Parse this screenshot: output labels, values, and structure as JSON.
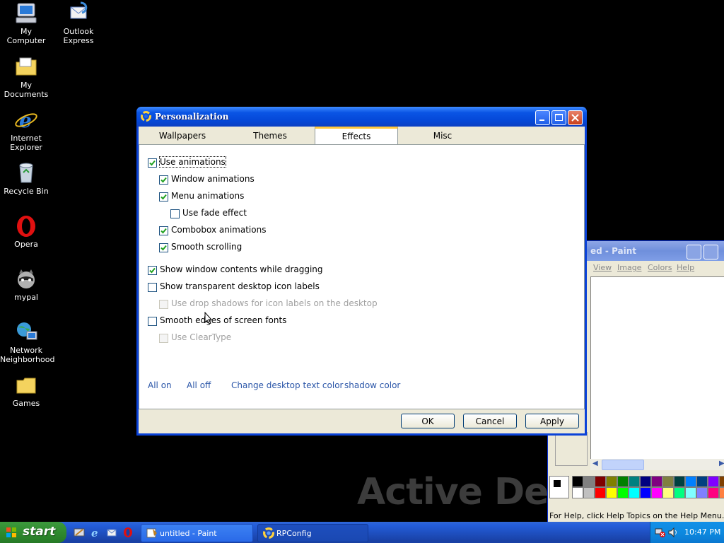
{
  "desktop": {
    "icons": [
      {
        "name": "My Computer"
      },
      {
        "name": "Outlook Express"
      },
      {
        "name": "My Documents"
      },
      {
        "name": "Internet Explorer"
      },
      {
        "name": "Recycle Bin"
      },
      {
        "name": "Opera"
      },
      {
        "name": "mypal"
      },
      {
        "name": "Network Neighborhood"
      },
      {
        "name": "Games"
      }
    ],
    "watermark": "Active Des"
  },
  "paint": {
    "title": "ed - Paint",
    "menu": [
      "View",
      "Image",
      "Colors",
      "Help"
    ],
    "status": "For Help, click Help Topics on the Help Menu.",
    "palette_top": [
      "#000000",
      "#808080",
      "#800000",
      "#808000",
      "#008000",
      "#008080",
      "#000080",
      "#800080",
      "#808040",
      "#004040",
      "#0080ff",
      "#004080",
      "#8000ff",
      "#804000"
    ],
    "palette_bottom": [
      "#ffffff",
      "#c0c0c0",
      "#ff0000",
      "#ffff00",
      "#00ff00",
      "#00ffff",
      "#0000ff",
      "#ff00ff",
      "#ffff80",
      "#00ff80",
      "#80ffff",
      "#8080ff",
      "#ff0080",
      "#ff8040"
    ]
  },
  "dialog": {
    "title": "Personalization",
    "tabs": [
      "Wallpapers",
      "Themes",
      "Effects",
      "Misc"
    ],
    "active_tab": "Effects",
    "options": {
      "use_animations": {
        "label": "Use animations",
        "checked": true
      },
      "window_animations": {
        "label": "Window animations",
        "checked": true
      },
      "menu_animations": {
        "label": "Menu animations",
        "checked": true
      },
      "use_fade_effect": {
        "label": "Use fade effect",
        "checked": false
      },
      "combobox_animations": {
        "label": "Combobox animations",
        "checked": true
      },
      "smooth_scrolling": {
        "label": "Smooth scrolling",
        "checked": true
      },
      "show_window_contents": {
        "label": "Show window contents while dragging",
        "checked": true
      },
      "transparent_icon_labels": {
        "label": "Show transparent desktop icon labels",
        "checked": false
      },
      "drop_shadows": {
        "label": "Use drop shadows for icon labels on the desktop",
        "checked": false,
        "disabled": true
      },
      "smooth_fonts": {
        "label": "Smooth edges of screen fonts",
        "checked": false
      },
      "use_cleartype": {
        "label": "Use ClearType",
        "checked": false,
        "disabled": true
      }
    },
    "links": {
      "all_on": "All on",
      "all_off": "All off",
      "change_color": "Change desktop text color",
      "shadow_color": "shadow color"
    },
    "buttons": {
      "ok": "OK",
      "cancel": "Cancel",
      "apply": "Apply"
    }
  },
  "taskbar": {
    "start": "start",
    "tasks": [
      "untitled - Paint",
      "RPConfig"
    ],
    "clock": "10:47 PM"
  }
}
